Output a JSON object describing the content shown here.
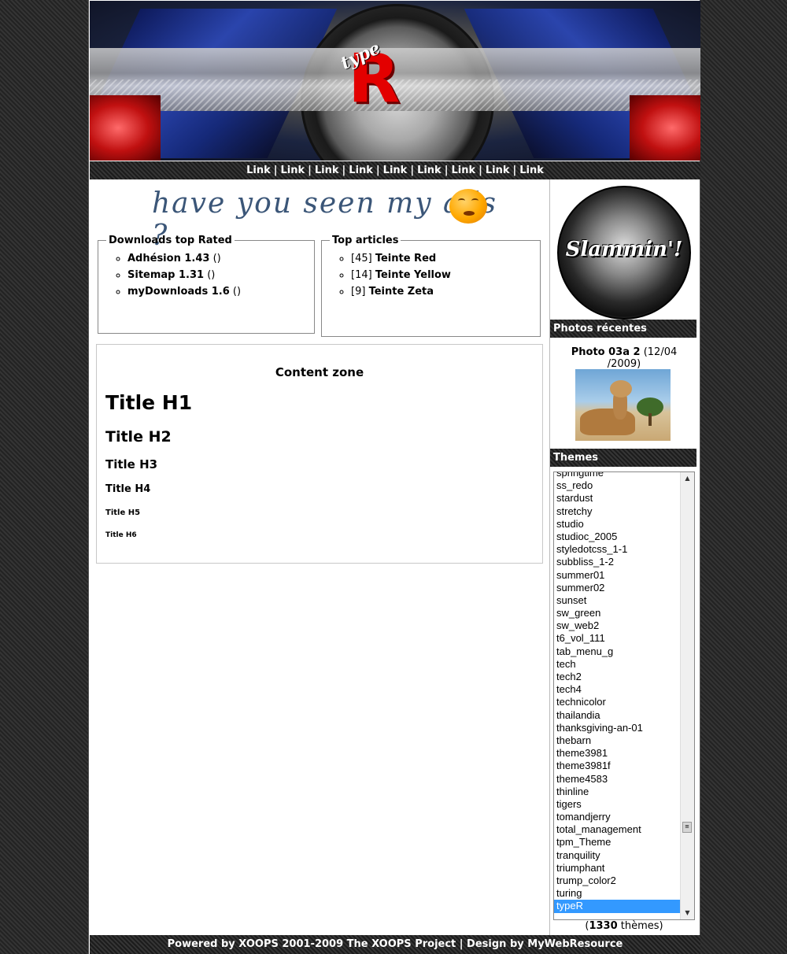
{
  "header": {
    "logo_small": "type",
    "logo_big": "R"
  },
  "nav": {
    "links": [
      "Link",
      "Link",
      "Link",
      "Link",
      "Link",
      "Link",
      "Link",
      "Link",
      "Link"
    ],
    "separator": "|"
  },
  "ads": {
    "text": "have you seen my ads ?"
  },
  "downloads_block": {
    "title": "Downloads top Rated",
    "items": [
      {
        "name": "Adhésion 1.43",
        "suffix": "()"
      },
      {
        "name": "Sitemap 1.31",
        "suffix": "()"
      },
      {
        "name": "myDownloads 1.6",
        "suffix": "()"
      }
    ]
  },
  "articles_block": {
    "title": "Top articles",
    "items": [
      {
        "count": "[45]",
        "name": "Teinte Red"
      },
      {
        "count": "[14]",
        "name": "Teinte Yellow"
      },
      {
        "count": "[9]",
        "name": "Teinte Zeta"
      }
    ]
  },
  "content": {
    "zone_title": "Content zone",
    "h1": "Title H1",
    "h2": "Title H2",
    "h3": "Title H3",
    "h4": "Title H4",
    "h5": "Title H5",
    "h6": "Title H6"
  },
  "right": {
    "slammin_text": "Slammin'!",
    "photos_title": "Photos récentes",
    "photo_name": "Photo 03a 2",
    "photo_date": "(12/04 /2009)",
    "themes_title": "Themes",
    "themes": [
      "springtime",
      "ss_redo",
      "stardust",
      "stretchy",
      "studio",
      "studioc_2005",
      "styledotcss_1-1",
      "subbliss_1-2",
      "summer01",
      "summer02",
      "sunset",
      "sw_green",
      "sw_web2",
      "t6_vol_111",
      "tab_menu_g",
      "tech",
      "tech2",
      "tech4",
      "technicolor",
      "thailandia",
      "thanksgiving-an-01",
      "thebarn",
      "theme3981",
      "theme3981f",
      "theme4583",
      "thinline",
      "tigers",
      "tomandjerry",
      "total_management",
      "tpm_Theme",
      "tranquility",
      "triumphant",
      "trump_color2",
      "turing",
      "typeR"
    ],
    "selected_theme": "typeR",
    "themes_count_open": "(",
    "themes_count": "1330",
    "themes_count_label": "thèmes)"
  },
  "footer": {
    "text": "Powered by XOOPS 2001-2009 The XOOPS Project | Design by MyWebResource"
  }
}
